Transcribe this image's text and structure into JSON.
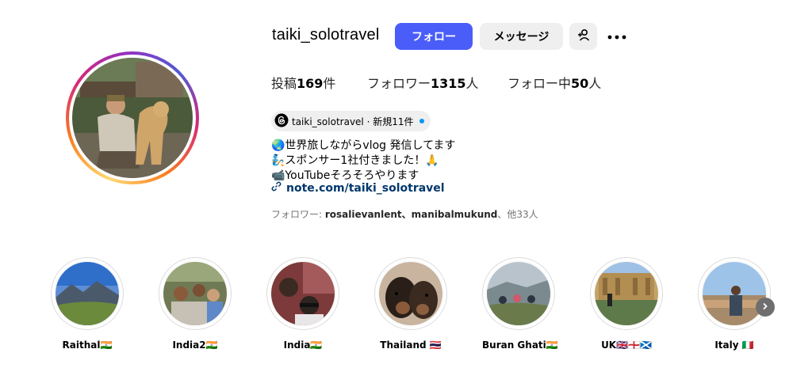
{
  "profile": {
    "username": "taiki_solotravel",
    "follow_label": "フォロー",
    "message_label": "メッセージ"
  },
  "stats": {
    "posts_prefix": "投稿",
    "posts_count": "169",
    "posts_suffix": "件",
    "followers_prefix": "フォロワー",
    "followers_count": "1315",
    "followers_suffix": "人",
    "following_prefix": "フォロー中",
    "following_count": "50",
    "following_suffix": "人"
  },
  "threads_badge": {
    "text": "taiki_solotravel · 新規11件"
  },
  "bio": {
    "line1": "🌏世界旅しながらvlog 発信してます",
    "line2": "🧞スポンサー1社付きました！🙏",
    "line3": "📹YouTubeそろそろやります",
    "link": "note.com/taiki_solotravel"
  },
  "followed_by": {
    "prefix": "フォロワー: ",
    "names": "rosalievanlent、manibalmukund",
    "suffix": "、他33人"
  },
  "highlights": [
    {
      "label": "Raithal🇮🇳"
    },
    {
      "label": "India2🇮🇳"
    },
    {
      "label": "India🇮🇳"
    },
    {
      "label": "Thailand 🇹🇭"
    },
    {
      "label": "Buran Ghati🇮🇳"
    },
    {
      "label": "UK🇬🇧🏴󠁧󠁢󠁥󠁮󠁧󠁿🏴󠁧󠁢󠁳󠁣󠁴󠁿"
    },
    {
      "label": "Italy 🇮🇹"
    }
  ],
  "colors": {
    "follow_button": "#4a5df9",
    "secondary_button": "#efefef",
    "link": "#00376b",
    "threads_dot": "#0095f6"
  },
  "icons": {
    "add_user": "add-user-icon",
    "more": "more-options-icon",
    "threads": "threads-icon",
    "link": "link-icon",
    "next": "chevron-right-icon"
  }
}
